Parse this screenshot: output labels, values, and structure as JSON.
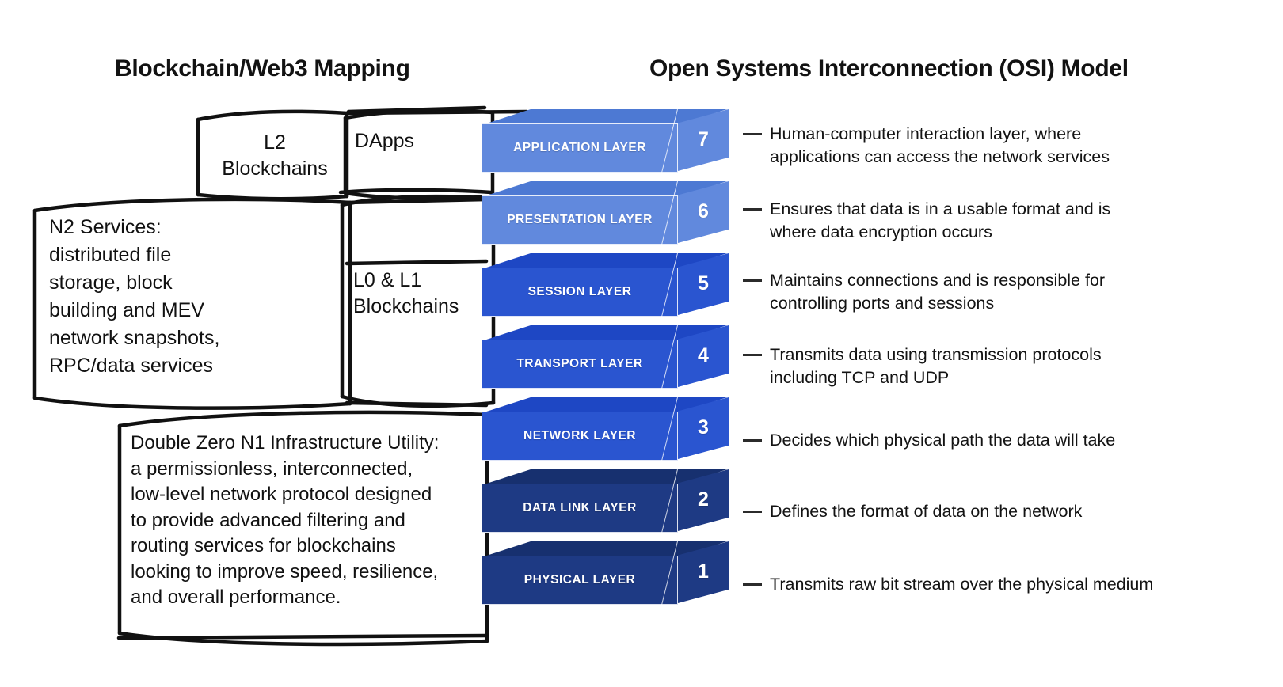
{
  "titles": {
    "left": "Blockchain/Web3 Mapping",
    "right": "Open Systems Interconnection (OSI) Model"
  },
  "colors": {
    "layer_light": "#6189DD",
    "layer_light_top": "#4D79D3",
    "layer_mid": "#2A55D0",
    "layer_mid_top": "#1E47C4",
    "layer_dark": "#1E3A84",
    "layer_dark_top": "#17306F",
    "text": "#131313",
    "line": "#111111"
  },
  "chart_data": {
    "type": "diagram",
    "title": "Open Systems Interconnection (OSI) Model",
    "layers": [
      {
        "number": "7",
        "name": "APPLICATION LAYER",
        "description": "Human-computer interaction layer, where\napplications can access the network services",
        "color_group": "light"
      },
      {
        "number": "6",
        "name": "PRESENTATION LAYER",
        "description": "Ensures that data is in a usable format and is\nwhere data encryption occurs",
        "color_group": "light"
      },
      {
        "number": "5",
        "name": "SESSION LAYER",
        "description": "Maintains connections and is responsible for\ncontrolling ports and sessions",
        "color_group": "mid"
      },
      {
        "number": "4",
        "name": "TRANSPORT LAYER",
        "description": "Transmits data using transmission protocols\nincluding TCP and UDP",
        "color_group": "mid"
      },
      {
        "number": "3",
        "name": "NETWORK LAYER",
        "description": "Decides which physical path the data will take",
        "color_group": "mid"
      },
      {
        "number": "2",
        "name": "DATA LINK LAYER",
        "description": "Defines the format of data on the network",
        "color_group": "dark"
      },
      {
        "number": "1",
        "name": "PHYSICAL LAYER",
        "description": "Transmits raw bit stream over the physical medium",
        "color_group": "dark"
      }
    ],
    "mapping_boxes": [
      {
        "id": "l2",
        "label": "L2\nBlockchains",
        "spans_layers": [
          "7"
        ]
      },
      {
        "id": "dapps",
        "label": "DApps",
        "spans_layers": [
          "7",
          "6"
        ]
      },
      {
        "id": "n2",
        "label": "N2 Services:\ndistributed file\nstorage, block\nbuilding and MEV\nnetwork snapshots,\nRPC/data services",
        "spans_layers": [
          "6",
          "5",
          "4"
        ]
      },
      {
        "id": "l0l1",
        "label": "L0 & L1\nBlockchains",
        "spans_layers": [
          "6",
          "5",
          "4"
        ]
      },
      {
        "id": "dz",
        "label": "Double Zero N1 Infrastructure Utility:\na permissionless, interconnected,\nlow-level network protocol designed\nto provide advanced filtering and\nrouting services for blockchains\nlooking to improve speed, resilience,\nand overall performance.",
        "spans_layers": [
          "3",
          "2",
          "1"
        ]
      }
    ]
  }
}
